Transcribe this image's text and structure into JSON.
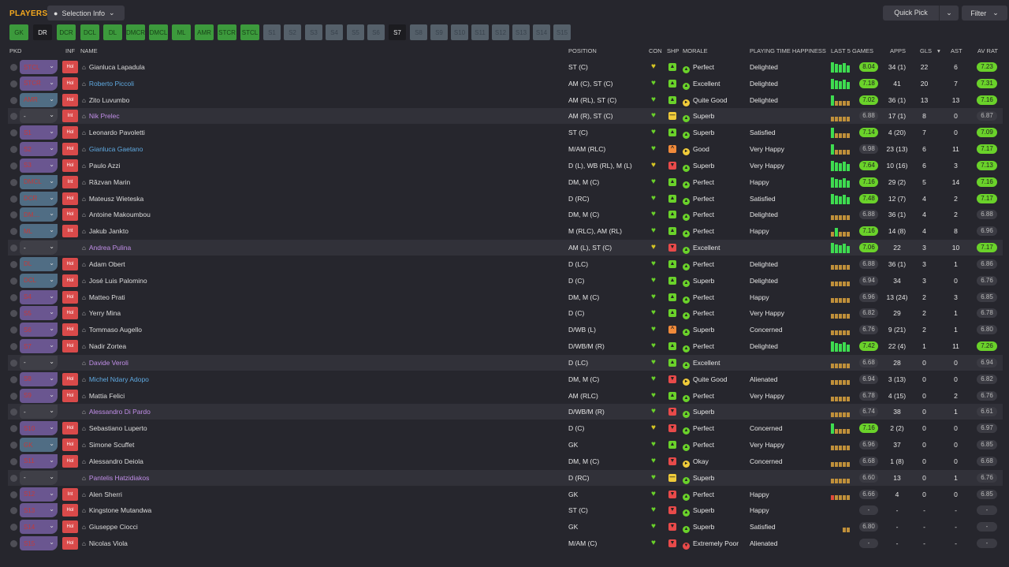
{
  "header": {
    "title": "PLAYERS",
    "selection_info": "Selection Info",
    "quick_pick": "Quick Pick",
    "filter": "Filter"
  },
  "chips": [
    {
      "l": "GK",
      "s": "g"
    },
    {
      "l": "DR",
      "s": "b"
    },
    {
      "l": "DCR",
      "s": "g"
    },
    {
      "l": "DCL",
      "s": "g"
    },
    {
      "l": "DL",
      "s": "g"
    },
    {
      "l": "DMCR",
      "s": "g"
    },
    {
      "l": "DMCL",
      "s": "g"
    },
    {
      "l": "ML",
      "s": "g"
    },
    {
      "l": "AMR",
      "s": "g"
    },
    {
      "l": "STCR",
      "s": "g"
    },
    {
      "l": "STCL",
      "s": "g"
    },
    {
      "l": "S1",
      "s": "d"
    },
    {
      "l": "S2",
      "s": "d"
    },
    {
      "l": "S3",
      "s": "d"
    },
    {
      "l": "S4",
      "s": "d"
    },
    {
      "l": "S5",
      "s": "d"
    },
    {
      "l": "S6",
      "s": "d"
    },
    {
      "l": "S7",
      "s": "b"
    },
    {
      "l": "S8",
      "s": "d"
    },
    {
      "l": "S9",
      "s": "d"
    },
    {
      "l": "S10",
      "s": "d"
    },
    {
      "l": "S11",
      "s": "d"
    },
    {
      "l": "S12",
      "s": "d"
    },
    {
      "l": "S13",
      "s": "d"
    },
    {
      "l": "S14",
      "s": "d"
    },
    {
      "l": "S15",
      "s": "d"
    }
  ],
  "columns": {
    "pkd": "PKD",
    "inf": "INF",
    "name": "NAME",
    "position": "POSITION",
    "con": "CON",
    "shp": "SHP",
    "morale": "MORALE",
    "pth": "PLAYING TIME HAPPINESS",
    "l5": "LAST 5 GAMES",
    "apps": "APPS",
    "gls": "GLS",
    "ast": "AST",
    "avr": "AV RAT"
  },
  "colors": {
    "green": "#6ad22a",
    "inf_tag": "#d94a4a",
    "accent": "#f5a91e"
  },
  "players": [
    {
      "pk": "STCL",
      "pc": "p",
      "inf": "Hol",
      "n": "Gianluca Lapadula",
      "nc": "w",
      "pos": "ST (C)",
      "con": "y",
      "shp": "g",
      "mo": "Perfect",
      "mc": "g",
      "pt": "Delighted",
      "l5": [
        "g",
        "g",
        "g",
        "g",
        "g"
      ],
      "l5r": "8.04",
      "l5g": true,
      "ap": "34 (1)",
      "gl": "22",
      "as": "6",
      "av": "7.23",
      "avg": true,
      "alt": false
    },
    {
      "pk": "STCR",
      "pc": "p",
      "inf": "Hol",
      "n": "Roberto Piccoli",
      "nc": "b",
      "pos": "AM (C), ST (C)",
      "con": "g",
      "shp": "g",
      "mo": "Excellent",
      "mc": "g",
      "pt": "Delighted",
      "l5": [
        "g",
        "g",
        "g",
        "g",
        "g"
      ],
      "l5r": "7.18",
      "l5g": true,
      "ap": "41",
      "gl": "20",
      "as": "7",
      "av": "7.31",
      "avg": true,
      "alt": false
    },
    {
      "pk": "AMR",
      "pc": "n",
      "inf": "Hol",
      "n": "Zito Luvumbo",
      "nc": "w",
      "pos": "AM (RL), ST (C)",
      "con": "g",
      "shp": "g",
      "mo": "Quite Good",
      "mc": "y",
      "pt": "Delighted",
      "l5": [
        "g",
        "o",
        "o",
        "o",
        "o"
      ],
      "l5r": "7.02",
      "l5g": true,
      "ap": "36 (1)",
      "gl": "13",
      "as": "13",
      "av": "7.16",
      "avg": true,
      "alt": false
    },
    {
      "pk": "-",
      "pc": "n",
      "inf": "Int",
      "n": "Nik Prelec",
      "nc": "p",
      "pos": "AM (R), ST (C)",
      "con": "g",
      "shp": "y",
      "mo": "Superb",
      "mc": "g",
      "pt": "",
      "l5": [
        "o",
        "o",
        "o",
        "o",
        "o"
      ],
      "l5r": "6.88",
      "l5g": false,
      "ap": "17 (1)",
      "gl": "8",
      "as": "0",
      "av": "6.87",
      "avg": false,
      "alt": true
    },
    {
      "pk": "S1",
      "pc": "p",
      "inf": "Hol",
      "n": "Leonardo Pavoletti",
      "nc": "w",
      "pos": "ST (C)",
      "con": "g",
      "shp": "g",
      "mo": "Superb",
      "mc": "g",
      "pt": "Satisfied",
      "l5": [
        "g",
        "o",
        "o",
        "o",
        "o"
      ],
      "l5r": "7.14",
      "l5g": true,
      "ap": "4 (20)",
      "gl": "7",
      "as": "0",
      "av": "7.09",
      "avg": true,
      "alt": false
    },
    {
      "pk": "S2",
      "pc": "p",
      "inf": "Hol",
      "n": "Gianluca Gaetano",
      "nc": "b",
      "pos": "M/AM (RLC)",
      "con": "g",
      "shp": "o",
      "mo": "Good",
      "mc": "y",
      "pt": "Very Happy",
      "l5": [
        "g",
        "o",
        "o",
        "o",
        "o"
      ],
      "l5r": "6.98",
      "l5g": false,
      "ap": "23 (13)",
      "gl": "6",
      "as": "11",
      "av": "7.17",
      "avg": true,
      "alt": false
    },
    {
      "pk": "S3",
      "pc": "p",
      "inf": "Hol",
      "n": "Paulo Azzi",
      "nc": "w",
      "pos": "D (L), WB (RL), M (L)",
      "con": "y",
      "shp": "r",
      "mo": "Superb",
      "mc": "g",
      "pt": "Very Happy",
      "l5": [
        "g",
        "g",
        "g",
        "g",
        "g"
      ],
      "l5r": "7.64",
      "l5g": true,
      "ap": "10 (16)",
      "gl": "6",
      "as": "3",
      "av": "7.13",
      "avg": true,
      "alt": false
    },
    {
      "pk": "DMCL",
      "pc": "n",
      "inf": "Int",
      "n": "Răzvan Marin",
      "nc": "w",
      "pos": "DM, M (C)",
      "con": "g",
      "shp": "g",
      "mo": "Perfect",
      "mc": "g",
      "pt": "Happy",
      "l5": [
        "g",
        "g",
        "g",
        "g",
        "g"
      ],
      "l5r": "7.16",
      "l5g": true,
      "ap": "29 (2)",
      "gl": "5",
      "as": "14",
      "av": "7.16",
      "avg": true,
      "alt": false
    },
    {
      "pk": "DCR",
      "pc": "n",
      "inf": "Hol",
      "n": "Mateusz Wieteska",
      "nc": "w",
      "pos": "D (RC)",
      "con": "g",
      "shp": "g",
      "mo": "Perfect",
      "mc": "g",
      "pt": "Satisfied",
      "l5": [
        "g",
        "g",
        "g",
        "g",
        "g"
      ],
      "l5r": "7.48",
      "l5g": true,
      "ap": "12 (7)",
      "gl": "4",
      "as": "2",
      "av": "7.17",
      "avg": true,
      "alt": false
    },
    {
      "pk": "DM…",
      "pc": "n",
      "inf": "Hol",
      "n": "Antoine Makoumbou",
      "nc": "w",
      "pos": "DM, M (C)",
      "con": "g",
      "shp": "g",
      "mo": "Perfect",
      "mc": "g",
      "pt": "Delighted",
      "l5": [
        "o",
        "o",
        "o",
        "o",
        "o"
      ],
      "l5r": "6.88",
      "l5g": false,
      "ap": "36 (1)",
      "gl": "4",
      "as": "2",
      "av": "6.88",
      "avg": false,
      "alt": false
    },
    {
      "pk": "ML",
      "pc": "n",
      "inf": "Int",
      "n": "Jakub Jankto",
      "nc": "w",
      "pos": "M (RLC), AM (RL)",
      "con": "g",
      "shp": "g",
      "mo": "Perfect",
      "mc": "g",
      "pt": "Happy",
      "l5": [
        "o",
        "g",
        "o",
        "o",
        "o"
      ],
      "l5r": "7.16",
      "l5g": true,
      "ap": "14 (8)",
      "gl": "4",
      "as": "8",
      "av": "6.96",
      "avg": false,
      "alt": false
    },
    {
      "pk": "-",
      "pc": "n",
      "inf": "",
      "n": "Andrea Pulina",
      "nc": "p",
      "pos": "AM (L), ST (C)",
      "con": "y",
      "shp": "r",
      "mo": "Excellent",
      "mc": "g",
      "pt": "",
      "l5": [
        "g",
        "g",
        "g",
        "g",
        "g"
      ],
      "l5r": "7.06",
      "l5g": true,
      "ap": "22",
      "gl": "3",
      "as": "10",
      "av": "7.17",
      "avg": true,
      "alt": true
    },
    {
      "pk": "DL",
      "pc": "n",
      "inf": "Hol",
      "n": "Adam Obert",
      "nc": "w",
      "pos": "D (LC)",
      "con": "g",
      "shp": "g",
      "mo": "Perfect",
      "mc": "g",
      "pt": "Delighted",
      "l5": [
        "o",
        "o",
        "o",
        "o",
        "o"
      ],
      "l5r": "6.88",
      "l5g": false,
      "ap": "36 (1)",
      "gl": "3",
      "as": "1",
      "av": "6.86",
      "avg": false,
      "alt": false
    },
    {
      "pk": "DCL",
      "pc": "n",
      "inf": "Hol",
      "n": "José Luis Palomino",
      "nc": "w",
      "pos": "D (C)",
      "con": "g",
      "shp": "g",
      "mo": "Superb",
      "mc": "g",
      "pt": "Delighted",
      "l5": [
        "o",
        "o",
        "o",
        "o",
        "o"
      ],
      "l5r": "6.94",
      "l5g": false,
      "ap": "34",
      "gl": "3",
      "as": "0",
      "av": "6.76",
      "avg": false,
      "alt": false
    },
    {
      "pk": "S4",
      "pc": "p",
      "inf": "Hol",
      "n": "Matteo Prati",
      "nc": "w",
      "pos": "DM, M (C)",
      "con": "g",
      "shp": "g",
      "mo": "Perfect",
      "mc": "g",
      "pt": "Happy",
      "l5": [
        "o",
        "o",
        "o",
        "o",
        "o"
      ],
      "l5r": "6.96",
      "l5g": false,
      "ap": "13 (24)",
      "gl": "2",
      "as": "3",
      "av": "6.85",
      "avg": false,
      "alt": false
    },
    {
      "pk": "S5",
      "pc": "p",
      "inf": "Hol",
      "n": "Yerry Mina",
      "nc": "w",
      "pos": "D (C)",
      "con": "g",
      "shp": "g",
      "mo": "Perfect",
      "mc": "g",
      "pt": "Very Happy",
      "l5": [
        "o",
        "o",
        "o",
        "o",
        "o"
      ],
      "l5r": "6.82",
      "l5g": false,
      "ap": "29",
      "gl": "2",
      "as": "1",
      "av": "6.78",
      "avg": false,
      "alt": false
    },
    {
      "pk": "S6",
      "pc": "p",
      "inf": "Hol",
      "n": "Tommaso Augello",
      "nc": "w",
      "pos": "D/WB (L)",
      "con": "g",
      "shp": "o",
      "mo": "Superb",
      "mc": "g",
      "pt": "Concerned",
      "l5": [
        "o",
        "o",
        "o",
        "o",
        "o"
      ],
      "l5r": "6.76",
      "l5g": false,
      "ap": "9 (21)",
      "gl": "2",
      "as": "1",
      "av": "6.80",
      "avg": false,
      "alt": false
    },
    {
      "pk": "S7",
      "pc": "p",
      "inf": "Hol",
      "n": "Nadir Zortea",
      "nc": "w",
      "pos": "D/WB/M (R)",
      "con": "g",
      "shp": "g",
      "mo": "Perfect",
      "mc": "g",
      "pt": "Delighted",
      "l5": [
        "g",
        "g",
        "g",
        "g",
        "g"
      ],
      "l5r": "7.42",
      "l5g": true,
      "ap": "22 (4)",
      "gl": "1",
      "as": "11",
      "av": "7.26",
      "avg": true,
      "alt": false
    },
    {
      "pk": "-",
      "pc": "n",
      "inf": "",
      "n": "Davide Veroli",
      "nc": "p",
      "pos": "D (LC)",
      "con": "g",
      "shp": "g",
      "mo": "Excellent",
      "mc": "g",
      "pt": "",
      "l5": [
        "o",
        "o",
        "o",
        "o",
        "o"
      ],
      "l5r": "6.68",
      "l5g": false,
      "ap": "28",
      "gl": "0",
      "as": "0",
      "av": "6.94",
      "avg": false,
      "alt": true
    },
    {
      "pk": "S8",
      "pc": "p",
      "inf": "Hol",
      "n": "Michel Ndary Adopo",
      "nc": "b",
      "pos": "DM, M (C)",
      "con": "g",
      "shp": "r",
      "mo": "Quite Good",
      "mc": "y",
      "pt": "Alienated",
      "l5": [
        "o",
        "o",
        "o",
        "o",
        "o"
      ],
      "l5r": "6.94",
      "l5g": false,
      "ap": "3 (13)",
      "gl": "0",
      "as": "0",
      "av": "6.82",
      "avg": false,
      "alt": false
    },
    {
      "pk": "S9",
      "pc": "p",
      "inf": "Hol",
      "n": "Mattia Felici",
      "nc": "w",
      "pos": "AM (RLC)",
      "con": "g",
      "shp": "g",
      "mo": "Perfect",
      "mc": "g",
      "pt": "Very Happy",
      "l5": [
        "o",
        "o",
        "o",
        "o",
        "o"
      ],
      "l5r": "6.78",
      "l5g": false,
      "ap": "4 (15)",
      "gl": "0",
      "as": "2",
      "av": "6.76",
      "avg": false,
      "alt": false
    },
    {
      "pk": "-",
      "pc": "n",
      "inf": "",
      "n": "Alessandro Di Pardo",
      "nc": "p",
      "pos": "D/WB/M (R)",
      "con": "g",
      "shp": "r",
      "mo": "Superb",
      "mc": "g",
      "pt": "",
      "l5": [
        "o",
        "o",
        "o",
        "o",
        "o"
      ],
      "l5r": "6.74",
      "l5g": false,
      "ap": "38",
      "gl": "0",
      "as": "1",
      "av": "6.61",
      "avg": false,
      "alt": true
    },
    {
      "pk": "S10",
      "pc": "p",
      "inf": "Hol",
      "n": "Sebastiano Luperto",
      "nc": "w",
      "pos": "D (C)",
      "con": "y",
      "shp": "r",
      "mo": "Perfect",
      "mc": "g",
      "pt": "Concerned",
      "l5": [
        "g",
        "o",
        "o",
        "o",
        "o"
      ],
      "l5r": "7.16",
      "l5g": true,
      "ap": "2 (2)",
      "gl": "0",
      "as": "0",
      "av": "6.97",
      "avg": false,
      "alt": false
    },
    {
      "pk": "GK",
      "pc": "n",
      "inf": "Hol",
      "n": "Simone Scuffet",
      "nc": "w",
      "pos": "GK",
      "con": "g",
      "shp": "g",
      "mo": "Perfect",
      "mc": "g",
      "pt": "Very Happy",
      "l5": [
        "o",
        "o",
        "o",
        "o",
        "o"
      ],
      "l5r": "6.96",
      "l5g": false,
      "ap": "37",
      "gl": "0",
      "as": "0",
      "av": "6.85",
      "avg": false,
      "alt": false
    },
    {
      "pk": "S11",
      "pc": "p",
      "inf": "Hol",
      "n": "Alessandro Deiola",
      "nc": "w",
      "pos": "DM, M (C)",
      "con": "g",
      "shp": "r",
      "mo": "Okay",
      "mc": "y",
      "pt": "Concerned",
      "l5": [
        "o",
        "o",
        "o",
        "o",
        "o"
      ],
      "l5r": "6.68",
      "l5g": false,
      "ap": "1 (8)",
      "gl": "0",
      "as": "0",
      "av": "6.68",
      "avg": false,
      "alt": false
    },
    {
      "pk": "-",
      "pc": "n",
      "inf": "",
      "n": "Pantelis Hatzidiakos",
      "nc": "p",
      "pos": "D (RC)",
      "con": "g",
      "shp": "y",
      "mo": "Superb",
      "mc": "g",
      "pt": "",
      "l5": [
        "o",
        "o",
        "o",
        "o",
        "o"
      ],
      "l5r": "6.60",
      "l5g": false,
      "ap": "13",
      "gl": "0",
      "as": "1",
      "av": "6.76",
      "avg": false,
      "alt": true
    },
    {
      "pk": "S12",
      "pc": "p",
      "inf": "Int",
      "n": "Alen Sherri",
      "nc": "w",
      "pos": "GK",
      "con": "g",
      "shp": "r",
      "mo": "Perfect",
      "mc": "g",
      "pt": "Happy",
      "l5": [
        "r",
        "o",
        "o",
        "o",
        "o"
      ],
      "l5r": "6.66",
      "l5g": false,
      "ap": "4",
      "gl": "0",
      "as": "0",
      "av": "6.85",
      "avg": false,
      "alt": false
    },
    {
      "pk": "S13",
      "pc": "p",
      "inf": "Hol",
      "n": "Kingstone Mutandwa",
      "nc": "w",
      "pos": "ST (C)",
      "con": "g",
      "shp": "r",
      "mo": "Superb",
      "mc": "g",
      "pt": "Happy",
      "l5": [],
      "l5r": "-",
      "l5g": false,
      "ap": "-",
      "gl": "-",
      "as": "-",
      "av": "-",
      "avg": false,
      "alt": false
    },
    {
      "pk": "S14",
      "pc": "p",
      "inf": "Hol",
      "n": "Giuseppe Ciocci",
      "nc": "w",
      "pos": "GK",
      "con": "g",
      "shp": "r",
      "mo": "Superb",
      "mc": "g",
      "pt": "Satisfied",
      "l5": [
        "o",
        "o"
      ],
      "l5r": "6.80",
      "l5g": false,
      "ap": "-",
      "gl": "-",
      "as": "-",
      "av": "-",
      "avg": false,
      "alt": false
    },
    {
      "pk": "S15",
      "pc": "p",
      "inf": "Hol",
      "n": "Nicolas Viola",
      "nc": "w",
      "pos": "M/AM (C)",
      "con": "g",
      "shp": "r",
      "mo": "Extremely Poor",
      "mc": "r",
      "pt": "Alienated",
      "l5": [],
      "l5r": "-",
      "l5g": false,
      "ap": "-",
      "gl": "-",
      "as": "-",
      "av": "-",
      "avg": false,
      "alt": false
    }
  ]
}
